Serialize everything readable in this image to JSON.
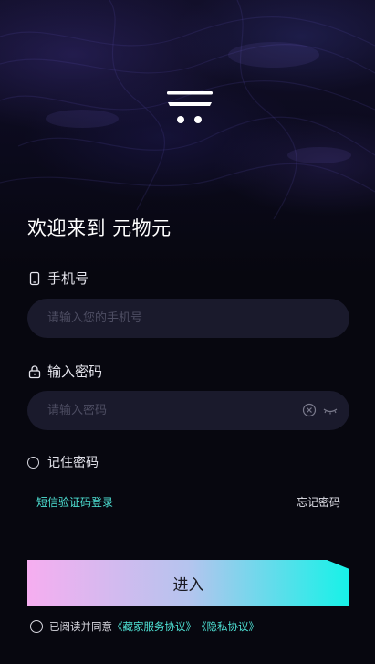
{
  "welcome": "欢迎来到 元物元",
  "phone": {
    "label": "手机号",
    "placeholder": "请输入您的手机号",
    "value": ""
  },
  "password": {
    "label": "输入密码",
    "placeholder": "请输入密码",
    "value": ""
  },
  "remember": {
    "label": "记住密码",
    "checked": false
  },
  "links": {
    "sms_login": "短信验证码登录",
    "forgot_password": "忘记密码"
  },
  "enter_button": "进入",
  "agreement": {
    "prefix": "已阅读并同意",
    "service": "《藏家服务协议》",
    "privacy": "《隐私协议》",
    "checked": false
  },
  "colors": {
    "accent": "#4fe3d6",
    "button_start": "#f6aef0",
    "button_end": "#16f2e8",
    "input_bg": "#1a1a2c",
    "background": "#07070f"
  },
  "icons": {
    "logo": "brand-logo",
    "phone": "phone-icon",
    "lock": "lock-icon",
    "clear": "clear-icon",
    "eye": "eye-closed-icon"
  }
}
